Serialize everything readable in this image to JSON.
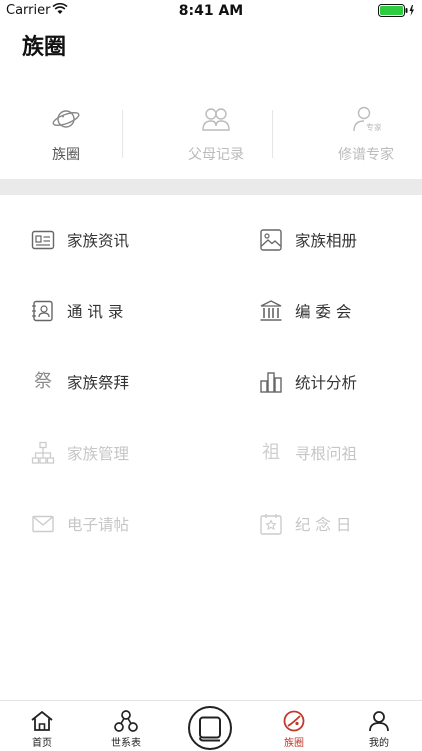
{
  "status_bar": {
    "carrier": "Carrier",
    "time": "8:41 AM"
  },
  "page_title": "族圈",
  "top_tabs": [
    {
      "label": "族圈",
      "icon": "planet-icon",
      "active": true
    },
    {
      "label": "父母记录",
      "icon": "parents-icon",
      "active": false
    },
    {
      "label": "修谱专家",
      "icon": "expert-icon",
      "active": false,
      "icon_badge": "专家"
    }
  ],
  "menu": {
    "left": [
      {
        "label": "家族资讯",
        "icon": "news-card-icon",
        "enabled": true
      },
      {
        "label": "通 讯 录",
        "icon": "contacts-icon",
        "enabled": true
      },
      {
        "label": "家族祭拜",
        "icon": "worship-icon",
        "icon_text": "祭",
        "enabled": true
      },
      {
        "label": "家族管理",
        "icon": "org-chart-icon",
        "enabled": false
      },
      {
        "label": "电子请帖",
        "icon": "mail-icon",
        "enabled": false
      }
    ],
    "right": [
      {
        "label": "家族相册",
        "icon": "photo-album-icon",
        "enabled": true
      },
      {
        "label": "编 委 会",
        "icon": "building-icon",
        "enabled": true
      },
      {
        "label": "统计分析",
        "icon": "bar-stats-icon",
        "enabled": true
      },
      {
        "label": "寻根问祖",
        "icon": "ancestor-icon",
        "icon_text": "祖",
        "enabled": false
      },
      {
        "label": "纪 念 日",
        "icon": "calendar-star-icon",
        "enabled": false
      }
    ]
  },
  "bottom_nav": [
    {
      "label": "首页",
      "icon": "home-icon",
      "active": false
    },
    {
      "label": "世系表",
      "icon": "tree-nodes-icon",
      "active": false
    },
    {
      "label": "族圈",
      "icon": "clan-circle-icon",
      "active": true
    },
    {
      "label": "我的",
      "icon": "person-icon",
      "active": false
    }
  ],
  "colors": {
    "accent": "#c0392b",
    "band": "#eaeaea",
    "disabled_text": "#c6c6c6"
  }
}
